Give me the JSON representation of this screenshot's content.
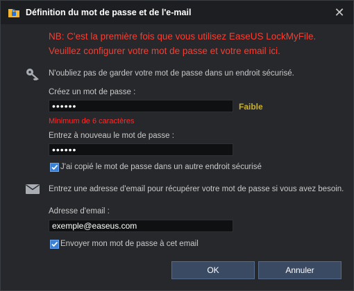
{
  "window": {
    "title": "Définition du mot de passe et de l'e-mail"
  },
  "note": {
    "line1": "NB: C'est la première fois que vous utilisez EaseUS LockMyFile.",
    "line2": "Veuillez configurer votre mot de passe et votre email ici."
  },
  "password_section": {
    "hint": "N'oubliez pas de garder votre mot de passe dans un endroit sécurisé.",
    "create_label": "Créez un mot de passe :",
    "create_value": "••••••",
    "strength": "Faible",
    "error": "Minimum de 6 caractères",
    "confirm_label": "Entrez à nouveau le mot de passe :",
    "confirm_value": "••••••",
    "copied_checkbox": "J'ai copié le mot de passe dans un autre endroit sécurisé"
  },
  "email_section": {
    "hint": "Entrez une adresse d'email pour récupérer votre mot de passe si vous avez besoin.",
    "email_label": "Adresse d'email :",
    "email_value": "exemple@easeus.com",
    "send_checkbox": "Envoyer mon mot de passe à cet email"
  },
  "buttons": {
    "ok": "OK",
    "cancel": "Annuler"
  },
  "icons": {
    "app": "lock-folder-icon",
    "key": "key-icon",
    "mail": "envelope-icon",
    "close": "close-icon"
  },
  "colors": {
    "note": "#ff3b2f",
    "strength": "#c9b12f",
    "error": "#ff2a2a",
    "accent": "#3b82d6"
  }
}
